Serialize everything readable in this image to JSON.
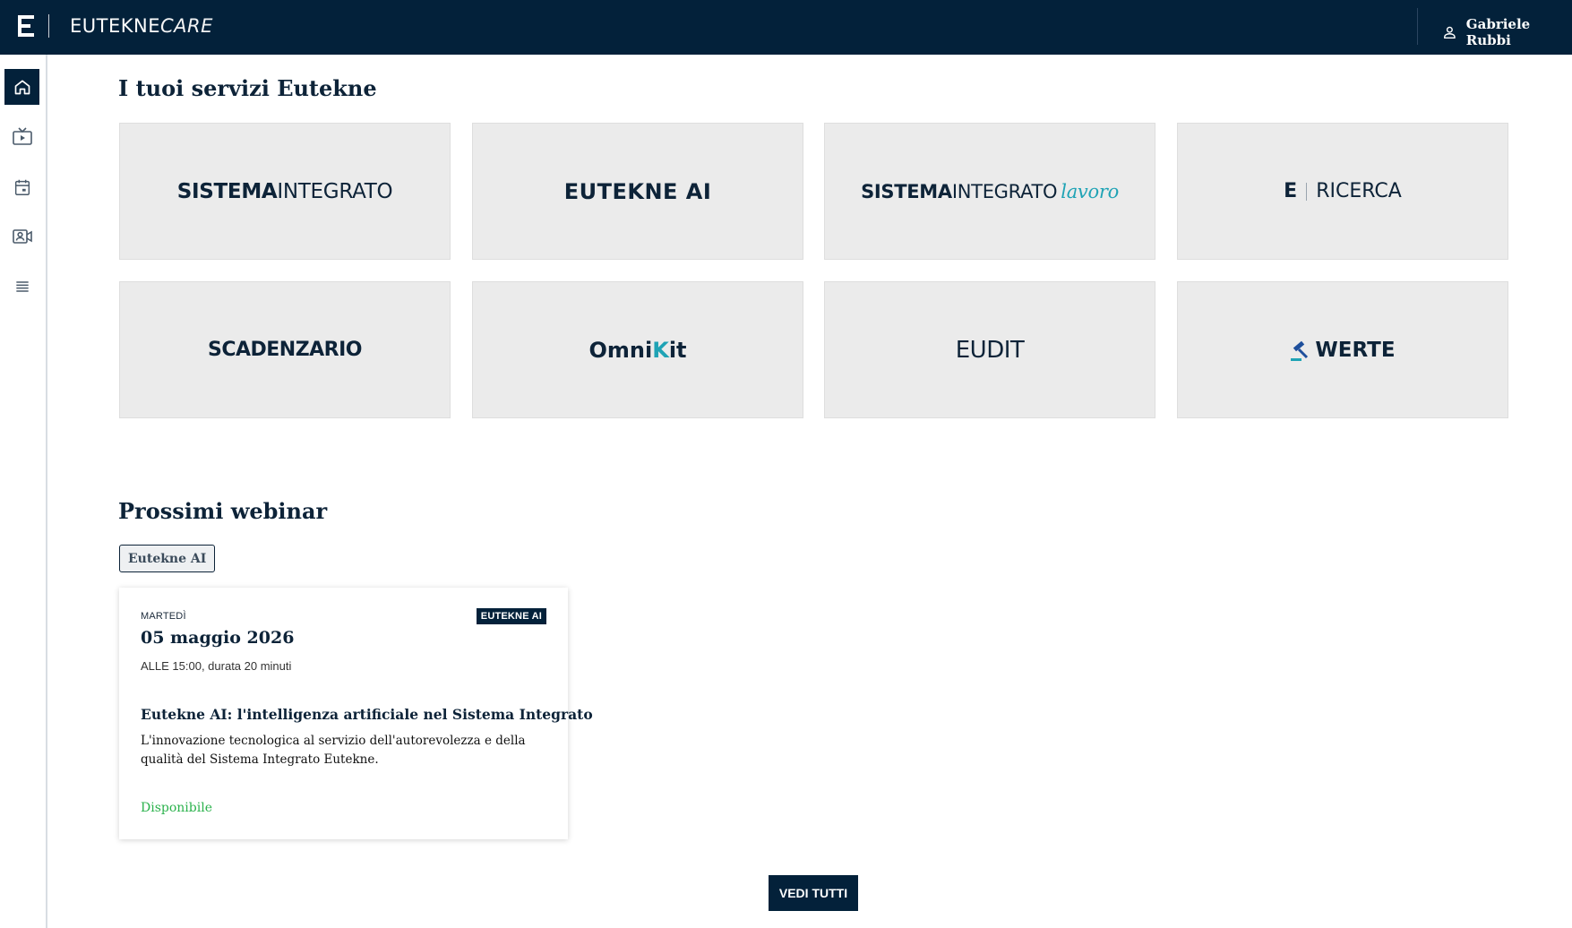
{
  "header": {
    "brand_main": "EUTEKNE",
    "brand_suffix": "CARE",
    "user_name": "Gabriele Rubbi"
  },
  "sidebar": {
    "items": [
      {
        "name": "home",
        "active": true
      },
      {
        "name": "tv"
      },
      {
        "name": "calendar"
      },
      {
        "name": "video-contact"
      },
      {
        "name": "list"
      }
    ]
  },
  "services": {
    "title": "I tuoi servizi Eutekne",
    "cards": [
      {
        "bold": "SISTEMA",
        "rest": "INTEGRATO"
      },
      {
        "text": "EUTEKNE AI"
      },
      {
        "bold": "SISTEMA",
        "rest": "INTEGRATO",
        "italic": "lavoro"
      },
      {
        "mark": "E",
        "text": "RICERCA"
      },
      {
        "text": "SCADENZARIO"
      },
      {
        "pre": "Omni",
        "accent": "K",
        "post": "it"
      },
      {
        "text": "EUDIT"
      },
      {
        "text": "WERTE"
      }
    ]
  },
  "webinars": {
    "title": "Prossimi webinar",
    "filter": "Eutekne AI",
    "item": {
      "day": "MARTEDÌ",
      "badge": "EUTEKNE AI",
      "date": "05 maggio 2026",
      "time": "ALLE 15:00, durata 20 minuti",
      "title": "Eutekne AI: l'intelligenza artificiale nel Sistema Integrato",
      "description": "L'innovazione tecnologica al servizio dell'autorevolezza e della qualità del Sistema Integrato Eutekne.",
      "status": "Disponibile",
      "status_color": "#2bb24c"
    },
    "see_all": "VEDI TUTTI"
  },
  "colors": {
    "navy": "#03213a",
    "accent_teal": "#1fa3b5",
    "werte_blue": "#1e4f9c"
  }
}
